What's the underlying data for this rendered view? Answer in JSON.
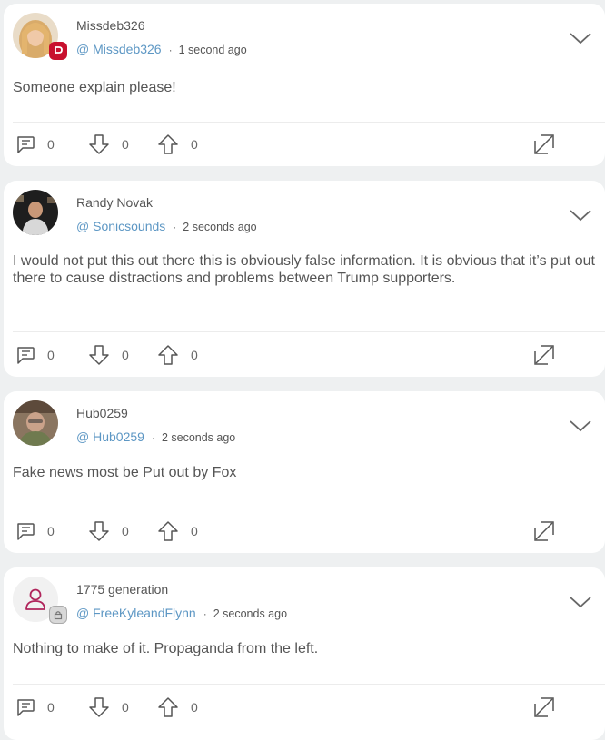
{
  "posts": [
    {
      "username": "Missdeb326",
      "handle": "@ Missdeb326",
      "time": "1 second ago",
      "text": "Someone explain please!",
      "comments": "0",
      "downvotes": "0",
      "upvotes": "0",
      "avatar_color": "#d8b48a",
      "badge": "red"
    },
    {
      "username": "Randy Novak",
      "handle": "@ Sonicsounds",
      "time": "2 seconds ago",
      "text": "I would not put this out there this is obviously false information. It is obvious that it’s put out there to cause distractions and problems between Trump supporters.",
      "comments": "0",
      "downvotes": "0",
      "upvotes": "0",
      "avatar_color": "#2b2b2b",
      "badge": "none"
    },
    {
      "username": "Hub0259",
      "handle": "@ Hub0259",
      "time": "2 seconds ago",
      "text": "Fake news most be Put out by Fox",
      "comments": "0",
      "downvotes": "0",
      "upvotes": "0",
      "avatar_color": "#6b5a4a",
      "badge": "none"
    },
    {
      "username": "1775 generation",
      "handle": "@ FreeKyleandFlynn",
      "time": "2 seconds ago",
      "text": "Nothing to make of it. Propaganda from the left.",
      "comments": "0",
      "downvotes": "0",
      "upvotes": "0",
      "avatar_color": "#f1f1f1",
      "badge": "grey"
    }
  ],
  "colors": {
    "handle": "#5d97c4",
    "badge_red": "#c8102e",
    "placeholder_avatar_icon": "#b0245b",
    "background": "#eef0f1"
  },
  "icons": [
    "comment-icon",
    "downvote-icon",
    "upvote-icon",
    "expand-icon",
    "chevron-down-icon"
  ]
}
